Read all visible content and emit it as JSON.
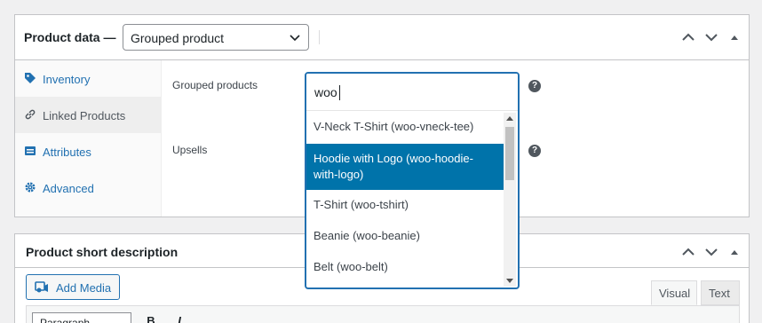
{
  "product_data": {
    "title": "Product data —",
    "product_type": "Grouped product",
    "tabs": [
      {
        "label": "Inventory",
        "icon": "tag-icon"
      },
      {
        "label": "Linked Products",
        "icon": "link-icon"
      },
      {
        "label": "Attributes",
        "icon": "list-icon"
      },
      {
        "label": "Advanced",
        "icon": "gear-icon"
      }
    ],
    "active_tab": "Linked Products",
    "fields": {
      "grouped_label": "Grouped products",
      "upsells_label": "Upsells",
      "help_glyph": "?"
    }
  },
  "dropdown": {
    "search_value": "woo",
    "options": [
      "V-Neck T-Shirt (woo-vneck-tee)",
      "Hoodie with Logo (woo-hoodie-with-logo)",
      "T-Shirt (woo-tshirt)",
      "Beanie (woo-beanie)",
      "Belt (woo-belt)"
    ],
    "highlighted_option": "Hoodie with Logo (woo-hoodie-with-logo)"
  },
  "short_description": {
    "title": "Product short description",
    "add_media_label": "Add Media",
    "editor_tabs": {
      "visual": "Visual",
      "text": "Text"
    },
    "format_select": "Paragraph",
    "toolbar_glyphs": {
      "bold": "B",
      "italic": "I"
    }
  },
  "colors": {
    "accent": "#2271b1",
    "highlight": "#0073aa",
    "border": "#c3c4c7"
  }
}
